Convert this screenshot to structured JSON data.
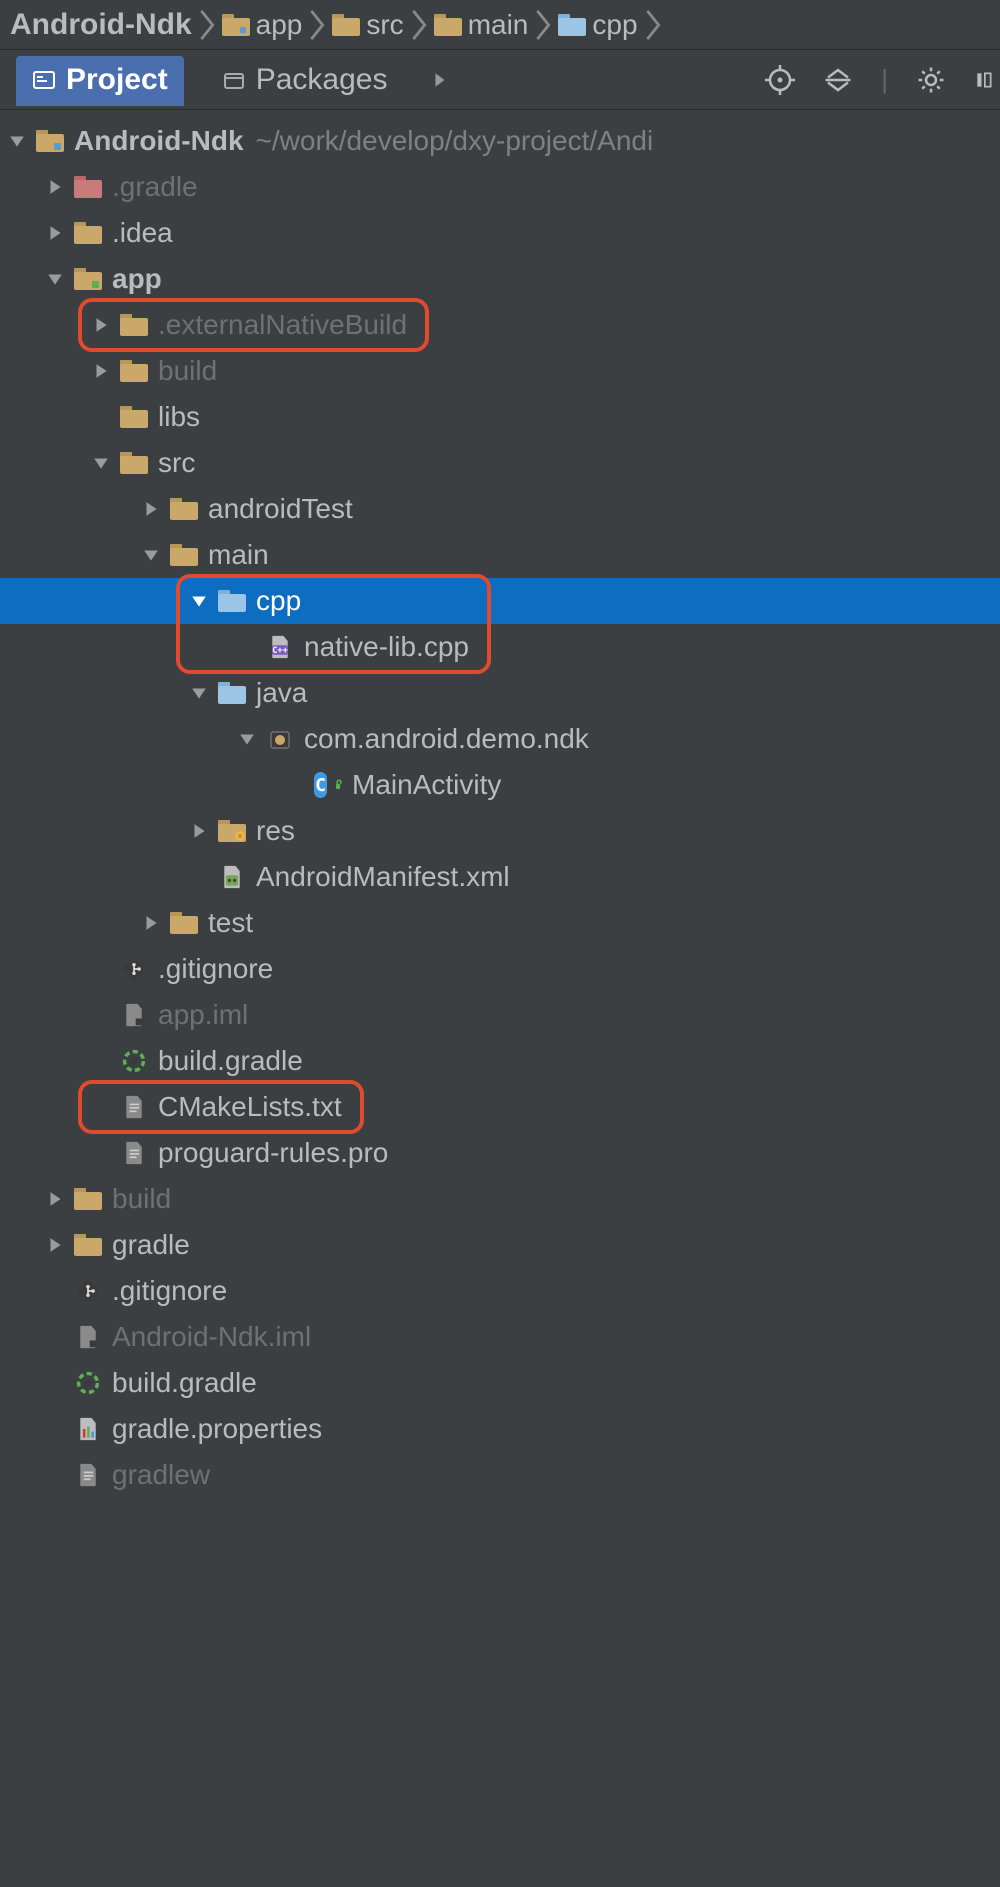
{
  "breadcrumb": [
    "Android-Ndk",
    "app",
    "src",
    "main",
    "cpp"
  ],
  "tabs": {
    "project": "Project",
    "packages": "Packages"
  },
  "tree": {
    "root": {
      "name": "Android-Ndk",
      "hint": "~/work/develop/dxy-project/Andi"
    },
    "items": [
      {
        "depth": 1,
        "expand": "r",
        "ic": "folder-red",
        "label": ".gradle",
        "dim": true
      },
      {
        "depth": 1,
        "expand": "r",
        "ic": "folder",
        "label": ".idea"
      },
      {
        "depth": 1,
        "expand": "d",
        "ic": "module",
        "label": "app",
        "bold": true
      },
      {
        "depth": 2,
        "expand": "r",
        "ic": "folder",
        "label": ".externalNativeBuild",
        "dim": true,
        "hl": 0
      },
      {
        "depth": 2,
        "expand": "r",
        "ic": "folder",
        "label": "build",
        "dim": true
      },
      {
        "depth": 2,
        "expand": "",
        "ic": "folder",
        "label": "libs"
      },
      {
        "depth": 2,
        "expand": "d",
        "ic": "folder",
        "label": "src"
      },
      {
        "depth": 3,
        "expand": "r",
        "ic": "folder",
        "label": "androidTest"
      },
      {
        "depth": 3,
        "expand": "d",
        "ic": "folder",
        "label": "main"
      },
      {
        "depth": 4,
        "expand": "d",
        "ic": "folder-blue",
        "label": "cpp",
        "selected": true,
        "hl": 1
      },
      {
        "depth": 5,
        "expand": "",
        "ic": "cpp",
        "label": "native-lib.cpp",
        "hl": 1
      },
      {
        "depth": 4,
        "expand": "d",
        "ic": "folder-blue",
        "label": "java"
      },
      {
        "depth": 5,
        "expand": "d",
        "ic": "package",
        "label": "com.android.demo.ndk"
      },
      {
        "depth": 6,
        "expand": "",
        "ic": "class",
        "label": "MainActivity"
      },
      {
        "depth": 4,
        "expand": "r",
        "ic": "folder-res",
        "label": "res"
      },
      {
        "depth": 4,
        "expand": "",
        "ic": "manifest",
        "label": "AndroidManifest.xml"
      },
      {
        "depth": 3,
        "expand": "r",
        "ic": "folder",
        "label": "test"
      },
      {
        "depth": 2,
        "expand": "",
        "ic": "git",
        "label": ".gitignore"
      },
      {
        "depth": 2,
        "expand": "",
        "ic": "iml",
        "label": "app.iml",
        "dim": true
      },
      {
        "depth": 2,
        "expand": "",
        "ic": "gradle",
        "label": "build.gradle"
      },
      {
        "depth": 2,
        "expand": "",
        "ic": "txt",
        "label": "CMakeLists.txt",
        "hl": 2
      },
      {
        "depth": 2,
        "expand": "",
        "ic": "txt",
        "label": "proguard-rules.pro"
      },
      {
        "depth": 1,
        "expand": "r",
        "ic": "folder",
        "label": "build",
        "dim": true
      },
      {
        "depth": 1,
        "expand": "r",
        "ic": "folder",
        "label": "gradle"
      },
      {
        "depth": 1,
        "expand": "",
        "ic": "git",
        "label": ".gitignore"
      },
      {
        "depth": 1,
        "expand": "",
        "ic": "iml",
        "label": "Android-Ndk.iml",
        "dim": true
      },
      {
        "depth": 1,
        "expand": "",
        "ic": "gradle",
        "label": "build.gradle"
      },
      {
        "depth": 1,
        "expand": "",
        "ic": "props",
        "label": "gradle.properties"
      },
      {
        "depth": 1,
        "expand": "",
        "ic": "txt",
        "label": "gradlew",
        "dim": true
      }
    ]
  }
}
